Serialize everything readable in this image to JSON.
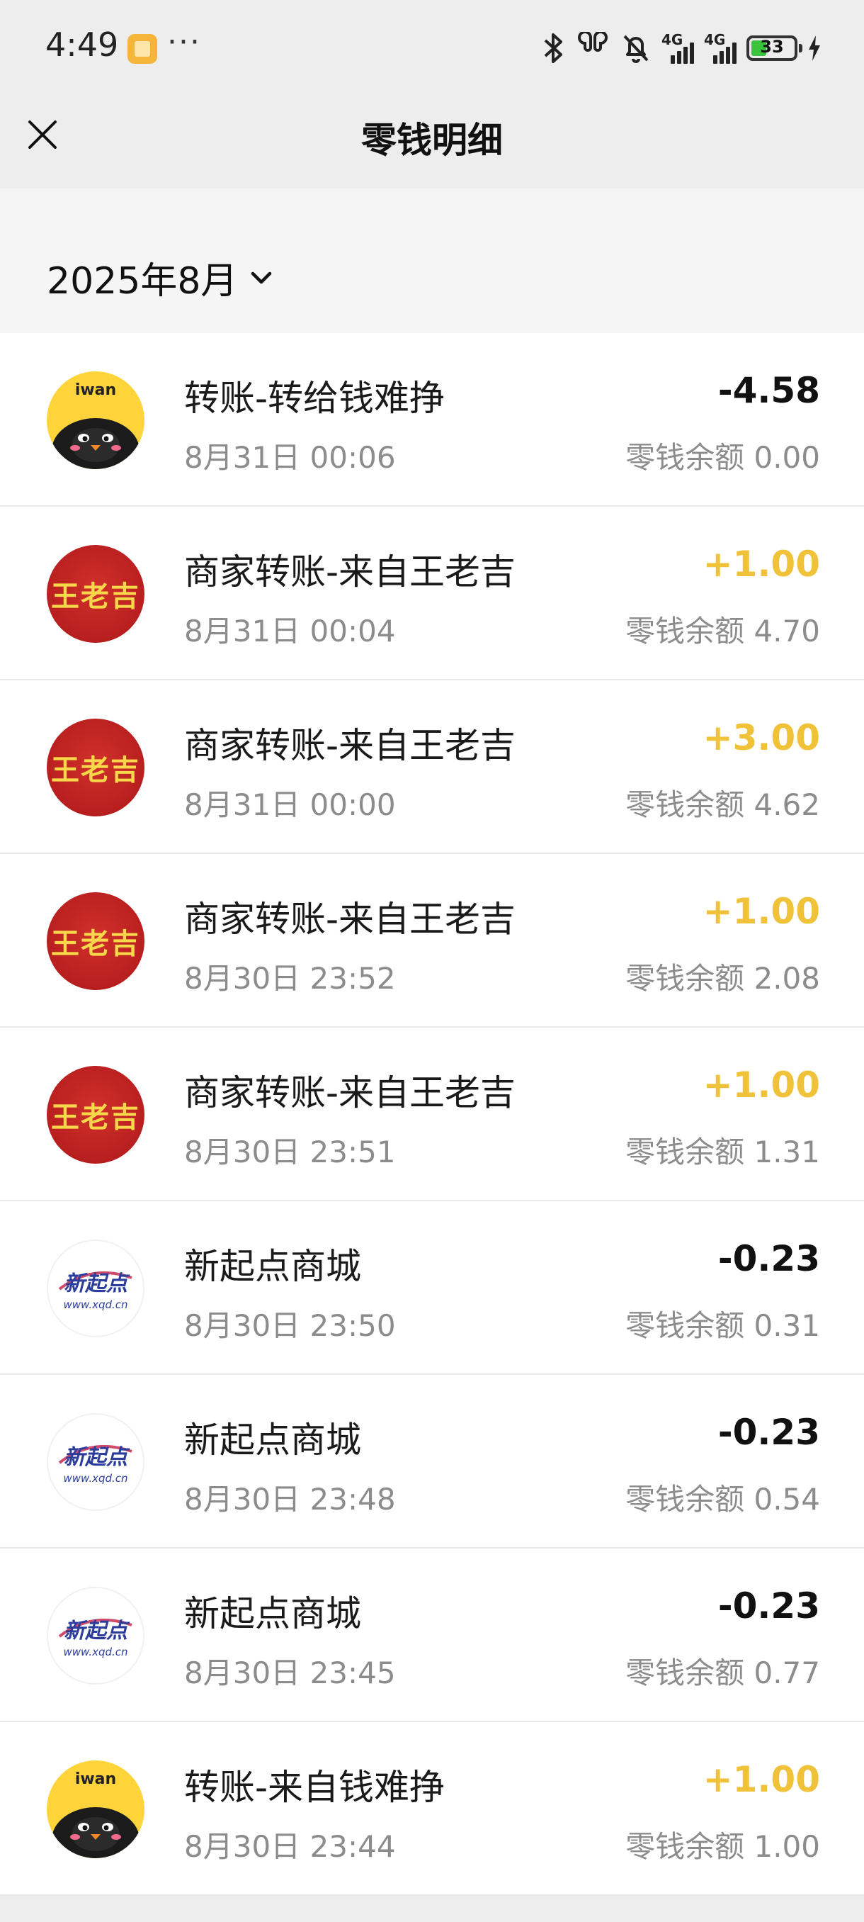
{
  "status_bar": {
    "time": "4:49",
    "more": "···",
    "network_1": "4G",
    "network_2": "4G",
    "battery": "33"
  },
  "header": {
    "title": "零钱明细"
  },
  "month_filter": {
    "label": "2025年8月"
  },
  "transactions": [
    {
      "title": "转账-转给钱难挣",
      "time": "8月31日 00:06",
      "amount": "-4.58",
      "direction": "out",
      "balance": "零钱余额 0.00",
      "avatar": "iwan-penguin",
      "avatar_text": "iwan"
    },
    {
      "title": "商家转账-来自王老吉",
      "time": "8月31日 00:04",
      "amount": "+1.00",
      "direction": "in",
      "balance": "零钱余额 4.70",
      "avatar": "wanglaoji",
      "avatar_text": "王老吉"
    },
    {
      "title": "商家转账-来自王老吉",
      "time": "8月31日 00:00",
      "amount": "+3.00",
      "direction": "in",
      "balance": "零钱余额 4.62",
      "avatar": "wanglaoji",
      "avatar_text": "王老吉"
    },
    {
      "title": "商家转账-来自王老吉",
      "time": "8月30日 23:52",
      "amount": "+1.00",
      "direction": "in",
      "balance": "零钱余额 2.08",
      "avatar": "wanglaoji",
      "avatar_text": "王老吉"
    },
    {
      "title": "商家转账-来自王老吉",
      "time": "8月30日 23:51",
      "amount": "+1.00",
      "direction": "in",
      "balance": "零钱余额 1.31",
      "avatar": "wanglaoji",
      "avatar_text": "王老吉"
    },
    {
      "title": "新起点商城",
      "time": "8月30日 23:50",
      "amount": "-0.23",
      "direction": "out",
      "balance": "零钱余额 0.31",
      "avatar": "xinqidian",
      "avatar_text": "新起点",
      "avatar_subtext": "www.xqd.cn"
    },
    {
      "title": "新起点商城",
      "time": "8月30日 23:48",
      "amount": "-0.23",
      "direction": "out",
      "balance": "零钱余额 0.54",
      "avatar": "xinqidian",
      "avatar_text": "新起点",
      "avatar_subtext": "www.xqd.cn"
    },
    {
      "title": "新起点商城",
      "time": "8月30日 23:45",
      "amount": "-0.23",
      "direction": "out",
      "balance": "零钱余额 0.77",
      "avatar": "xinqidian",
      "avatar_text": "新起点",
      "avatar_subtext": "www.xqd.cn"
    },
    {
      "title": "转账-来自钱难挣",
      "time": "8月30日 23:44",
      "amount": "+1.00",
      "direction": "in",
      "balance": "零钱余额 1.00",
      "avatar": "iwan-penguin",
      "avatar_text": "iwan"
    }
  ],
  "colors": {
    "income": "#f0c23a",
    "expense": "#111111",
    "page_bg": "#ededed",
    "wanglaoji_red": "#b81f1f",
    "xqd_blue": "#2c3d9c",
    "iwan_yellow": "#ffd43b"
  }
}
